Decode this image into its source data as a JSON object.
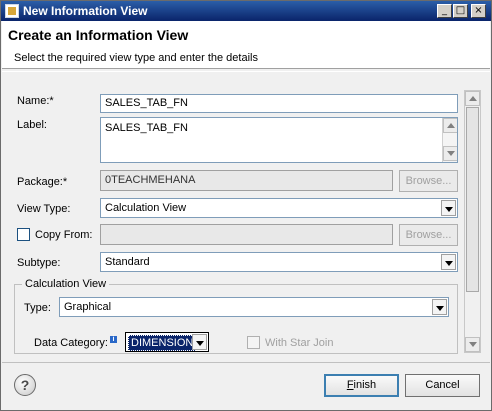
{
  "window": {
    "title": "New Information View"
  },
  "header": {
    "title": "Create an Information View",
    "description": "Select the required view type and enter the details"
  },
  "form": {
    "name_label": "Name:*",
    "name_value": "SALES_TAB_FN",
    "label_label": "Label:",
    "label_value": "SALES_TAB_FN",
    "package_label": "Package:*",
    "package_value": "0TEACHMEHANA",
    "browse_label": "Browse...",
    "view_type_label": "View Type:",
    "view_type_value": "Calculation View",
    "copy_from_label": "Copy From:",
    "copy_from_checked": false,
    "copy_from_value": "",
    "subtype_label": "Subtype:",
    "subtype_value": "Standard"
  },
  "calc_group": {
    "title": "Calculation View",
    "type_label": "Type:",
    "type_value": "Graphical",
    "data_category_label": "Data Category:",
    "data_category_value": "DIMENSION",
    "star_join_label": "With Star Join",
    "star_join_checked": false
  },
  "footer": {
    "help_icon": "?",
    "finish_label": "Finish",
    "cancel_label": "Cancel"
  },
  "icons": {
    "minimize": "_",
    "maximize": "□",
    "close": "×",
    "info": "i"
  },
  "colors": {
    "titlebar": "#0a246a",
    "selection": "#0a246a",
    "default_button_border": "#3c7fb1"
  }
}
